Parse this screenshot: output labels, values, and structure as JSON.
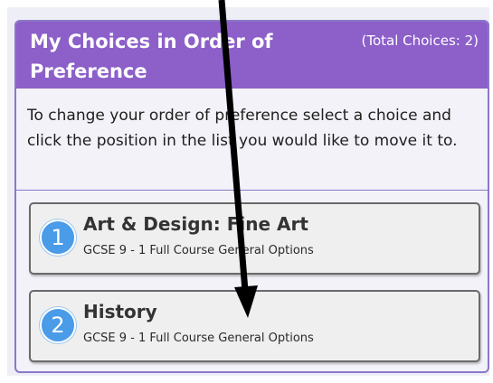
{
  "panel": {
    "title": "My Choices in Order of Preference",
    "total_choices": "(Total Choices: 2)",
    "instructions": "To change your order of preference select a choice and click the position in the list you would like to move it to."
  },
  "choices": [
    {
      "position": "1",
      "title": "Art & Design: Fine Art",
      "subtitle": "GCSE 9 - 1 Full Course General Options"
    },
    {
      "position": "2",
      "title": "History",
      "subtitle": "GCSE 9 - 1 Full Course General Options"
    }
  ],
  "colors": {
    "header": "#8c5fc9",
    "border": "#8b78c9",
    "badge": "#4a9be8",
    "annotation_arrow": "#000000"
  }
}
